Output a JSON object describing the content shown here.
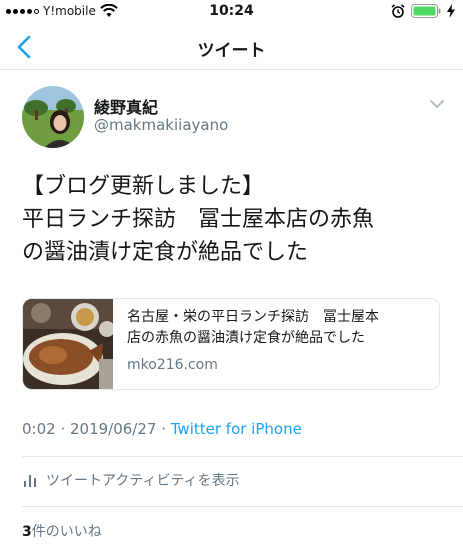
{
  "status_bar": {
    "carrier": "Y!mobile",
    "time": "10:24"
  },
  "nav": {
    "title": "ツイート"
  },
  "tweet": {
    "author_name": "綾野真紀",
    "author_handle": "@makmakiiayano",
    "text_lines": [
      "【ブログ更新しました】",
      "平日ランチ探訪　冨士屋本店の赤魚",
      "の醤油漬け定食が絶品でした"
    ],
    "card": {
      "title_lines": [
        "名古屋・栄の平日ランチ探訪　冨士屋本",
        "店の赤魚の醤油漬け定食が絶品でした"
      ],
      "domain": "mko216.com"
    },
    "timestamp": "0:02 · 2019/06/27 · ",
    "source": "Twitter for iPhone",
    "activity_label": "ツイートアクティビティを表示",
    "likes_count": "3",
    "likes_label": "件のいいね"
  },
  "colors": {
    "accent": "#1da1f2",
    "secondary_text": "#657786",
    "divider": "#e1e8ed",
    "battery": "#4cd964"
  },
  "icons": [
    "signal-icon",
    "wifi-icon",
    "alarm-icon",
    "battery-icon",
    "charging-icon",
    "back-arrow-icon",
    "chevron-down-icon",
    "activity-chart-icon"
  ]
}
